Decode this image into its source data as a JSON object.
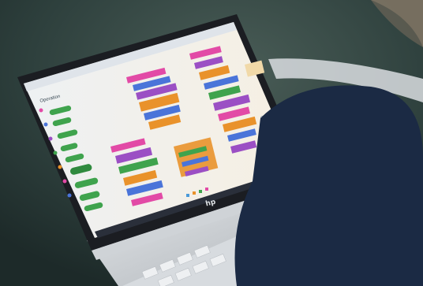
{
  "scene": {
    "description_tags": [
      "laptop",
      "block-coding-app",
      "person",
      "dark-background"
    ],
    "colors": {
      "background": "#2c3f3d",
      "laptop_body": "#c9cdd1",
      "screen_bezel": "#1b1d22",
      "screen_bg": "#f2ede4",
      "block_green": "#3fa34d",
      "block_orange": "#e9922b",
      "block_purple": "#9b4fc4",
      "block_pink": "#e24aa6",
      "block_blue": "#4a74d9",
      "person_navy": "#1b2a44"
    }
  },
  "laptop": {
    "brand_logo": "hp",
    "screen": {
      "panel_title": "Operation"
    }
  }
}
